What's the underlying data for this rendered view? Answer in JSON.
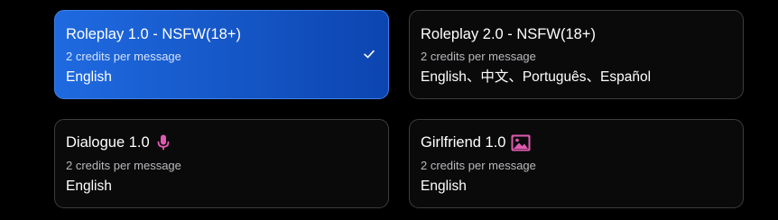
{
  "cards": [
    {
      "title": "Roleplay 1.0 - NSFW(18+)",
      "credits": "2 credits per message",
      "languages": "English",
      "selected": true,
      "icon": "checkmark-icon"
    },
    {
      "title": "Roleplay 2.0 - NSFW(18+)",
      "credits": "2 credits per message",
      "languages": "English、中文、Português、Español",
      "selected": false
    },
    {
      "title": "Dialogue 1.0",
      "credits": "2 credits per message",
      "languages": "English",
      "selected": false,
      "icon": "microphone-icon"
    },
    {
      "title": "Girlfriend 1.0",
      "credits": "2 credits per message",
      "languages": "English",
      "selected": false,
      "icon": "image-icon"
    }
  ],
  "colors": {
    "selected_card": "#1a5fd6",
    "card_border": "#3d3d3f",
    "icon_accent": "#e05bb0",
    "background": "#000000"
  }
}
